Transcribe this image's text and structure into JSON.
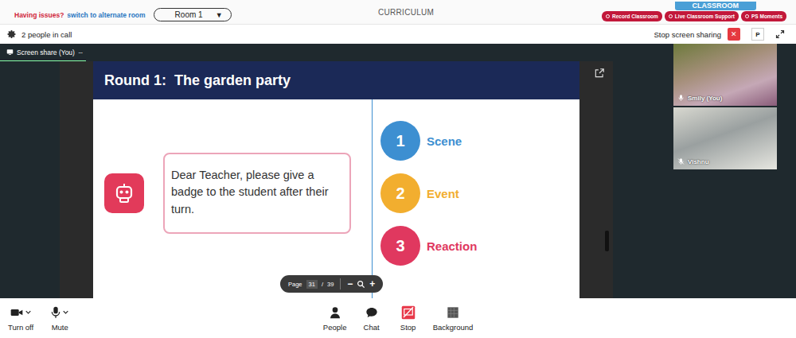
{
  "top_bar": {
    "issue_label": "Having issues?",
    "alternate_link": "switch to alternate room",
    "room": "Room 1",
    "room_caret": "▼",
    "title": "CURRICULUM",
    "corner_tab": "CLASSROOM",
    "actions": [
      "Record Classroom",
      "Live Classroom Support",
      "PS Moments"
    ]
  },
  "call_bar": {
    "people_count": "2 people in call",
    "stop_share": "Stop screen sharing",
    "stop_share_icon": "✕",
    "presenter_badge": "P"
  },
  "share_tab": {
    "label": "Screen share (You)",
    "more": "···"
  },
  "slide": {
    "title": "Round 1:  The garden party",
    "message": "Dear Teacher, please give a badge to the student after their turn.",
    "steps": [
      {
        "number": "1",
        "label": "Scene",
        "color": "#3d8fd1"
      },
      {
        "number": "2",
        "label": "Event",
        "color": "#f2ae2f"
      },
      {
        "number": "3",
        "label": "Reaction",
        "color": "#e0385f"
      }
    ]
  },
  "pager": {
    "label": "Page",
    "current": "31",
    "separator": "/",
    "total": "39",
    "zoom_out": "−",
    "zoom_in": "+"
  },
  "participants": [
    {
      "name": "Smily (You)",
      "muted": false
    },
    {
      "name": "Vishnu",
      "muted": true
    }
  ],
  "toolbar": {
    "left": [
      {
        "label": "Turn off",
        "kind": "camera"
      },
      {
        "label": "Mute",
        "kind": "mic"
      }
    ],
    "center": [
      {
        "label": "People",
        "kind": "people"
      },
      {
        "label": "Chat",
        "kind": "chat"
      },
      {
        "label": "Stop",
        "kind": "stop"
      },
      {
        "label": "Background",
        "kind": "background"
      }
    ]
  }
}
